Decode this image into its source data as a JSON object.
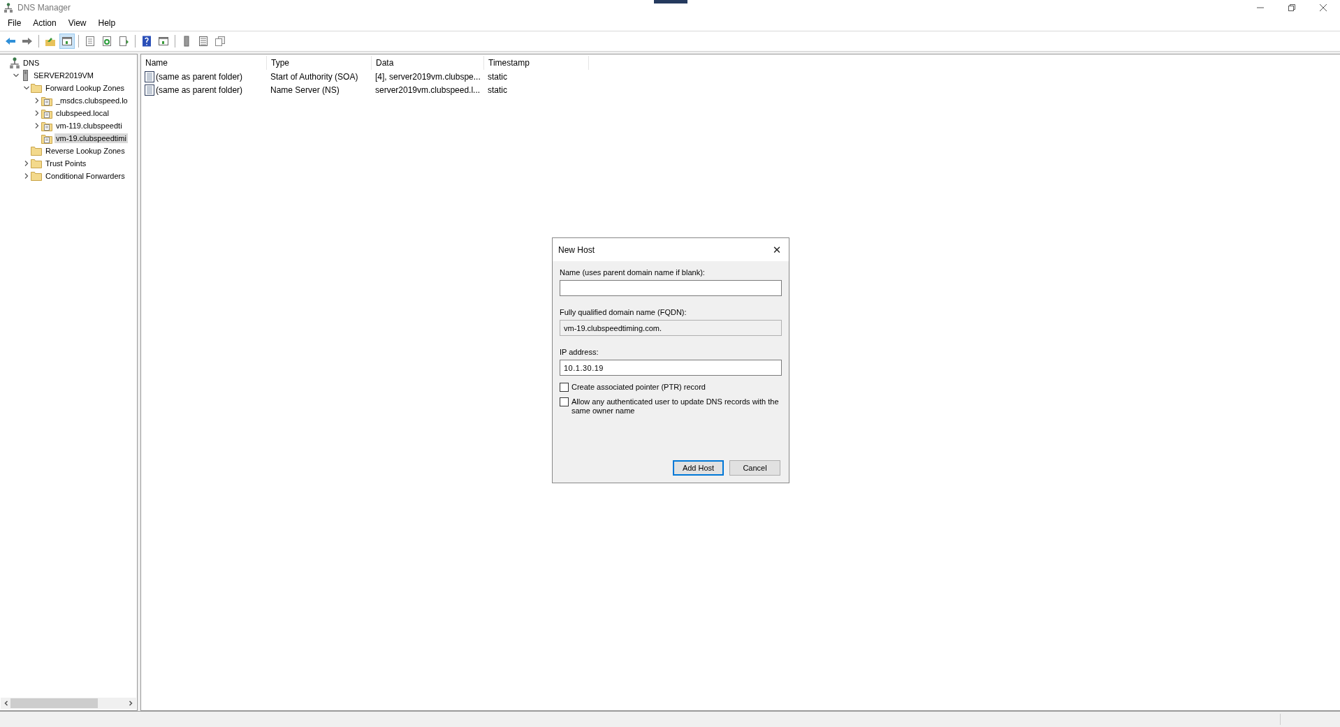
{
  "window": {
    "title": "DNS Manager"
  },
  "menu": [
    "File",
    "Action",
    "View",
    "Help"
  ],
  "toolbar": [
    [
      {
        "kind": "back",
        "pressed": false
      },
      {
        "kind": "forward",
        "pressed": false
      }
    ],
    [
      {
        "kind": "up",
        "pressed": false
      },
      {
        "kind": "tree",
        "pressed": true
      }
    ],
    [
      {
        "kind": "props",
        "pressed": false
      },
      {
        "kind": "refresh",
        "pressed": false
      },
      {
        "kind": "export",
        "pressed": false
      }
    ],
    [
      {
        "kind": "help",
        "pressed": false
      },
      {
        "kind": "panel",
        "pressed": false
      }
    ],
    [
      {
        "kind": "server",
        "pressed": false
      },
      {
        "kind": "list",
        "pressed": false
      },
      {
        "kind": "copy",
        "pressed": false
      }
    ]
  ],
  "tree": [
    {
      "label": "DNS",
      "kind": "root",
      "selected": false,
      "children": [
        {
          "label": "SERVER2019VM",
          "kind": "server",
          "expanded": true,
          "selected": false,
          "children": [
            {
              "label": "Forward Lookup Zones",
              "kind": "folder",
              "expanded": true,
              "selected": false,
              "children": [
                {
                  "label": "_msdcs.clubspeed.lo",
                  "kind": "zone",
                  "expanded": false,
                  "selected": false
                },
                {
                  "label": "clubspeed.local",
                  "kind": "zone",
                  "expanded": false,
                  "selected": false
                },
                {
                  "label": "vm-119.clubspeedti",
                  "kind": "zone",
                  "expanded": false,
                  "selected": false
                },
                {
                  "label": "vm-19.clubspeedtimi",
                  "kind": "zone",
                  "selected": true
                }
              ]
            },
            {
              "label": "Reverse Lookup Zones",
              "kind": "folder",
              "selected": false
            },
            {
              "label": "Trust Points",
              "kind": "folder",
              "expanded": false,
              "selected": false
            },
            {
              "label": "Conditional Forwarders",
              "kind": "folder",
              "expanded": false,
              "selected": false
            }
          ]
        }
      ]
    }
  ],
  "table": {
    "columns": [
      "Name",
      "Type",
      "Data",
      "Timestamp"
    ],
    "rows": [
      [
        "(same as parent folder)",
        "Start of Authority (SOA)",
        "[4], server2019vm.clubspe...",
        "static"
      ],
      [
        "(same as parent folder)",
        "Name Server (NS)",
        "server2019vm.clubspeed.l...",
        "static"
      ]
    ]
  },
  "dialog": {
    "title": "New Host",
    "close": "✕",
    "name_label": "Name (uses parent domain name if blank):",
    "fqdn_label": "Fully qualified domain name (FQDN):",
    "fqdn_value": "vm-19.clubspeedtiming.com.",
    "ip_label": "IP address:",
    "ip_value": "10.1.30.19",
    "checkboxes": [
      {
        "label": "Create associated pointer (PTR) record",
        "checked": false
      },
      {
        "label": "Allow any authenticated user to update DNS records with the same owner name",
        "checked": false
      }
    ],
    "buttons": [
      {
        "label": "Add Host",
        "default": true
      },
      {
        "label": "Cancel",
        "default": false
      }
    ]
  }
}
